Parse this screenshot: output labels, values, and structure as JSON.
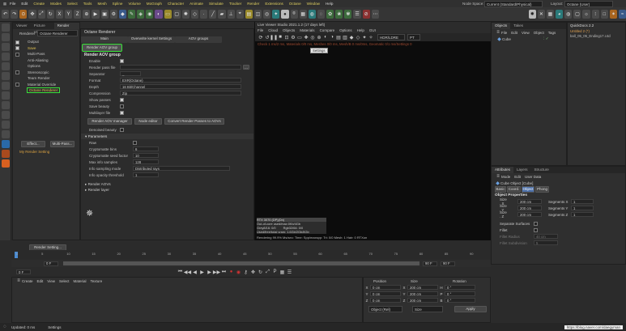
{
  "menubar": {
    "items": [
      "File",
      "Edit",
      "Create",
      "Modes",
      "Select",
      "Tools",
      "Mesh",
      "Spline",
      "Volume",
      "MoGraph",
      "Character",
      "Animate",
      "Simulate",
      "Tracker",
      "Render",
      "Extensions",
      "Octane",
      "Window",
      "Help"
    ],
    "node_space_label": "Node Space:",
    "node_space_value": "Current (Standard/Physical)",
    "layout_label": "Layout:",
    "layout_value": "Octane (User)"
  },
  "left_panel": {
    "tabs": [
      "Viewer",
      "Picture Viewer",
      "Render Settings"
    ],
    "renderer_label": "Renderer",
    "renderer_value": "Octane Renderer",
    "tree": [
      "Output",
      "Save",
      "Multi-Pass",
      "Anti-Aliasing",
      "Options",
      "Stereoscopic",
      "Team Render",
      "Material Override",
      "Octane Renderer"
    ],
    "effect_button": "Effect...",
    "multipass_button": "Multi-Pass...",
    "my_render_setting": "My Render Setting",
    "render_setting_button": "Render Setting..."
  },
  "octane": {
    "title": "Octane Renderer",
    "tab_row1": [
      "Main",
      "Overwrite kernel Settings",
      "AOV groups"
    ],
    "tab_active": "Render AOV group",
    "section": "Render AOV group",
    "enable_label": "Enable",
    "render_pass_file_label": "Render pass file",
    "separator_label": "Separator",
    "separator_value": "_",
    "format_label": "Format",
    "format_value": "EXR(Octane)",
    "depth_label": "Depth",
    "depth_value": "16 Bit/Channel",
    "compression_label": "Compression",
    "compression_value": "Zip",
    "show_passes_label": "Show passes",
    "save_beauty_label": "Save beauty",
    "multilayer_label": "Multilayer file",
    "btn_aov_manager": "Render AOV manager",
    "btn_node_editor": "Node editor",
    "btn_convert": "Convert Render Passes to AOVs",
    "denoised_label": "Denoised beauty",
    "parameters": "Parameters",
    "raw_label": "Raw",
    "crypto_bins_label": "Cryptomatte bins",
    "crypto_bins_value": "6",
    "crypto_seed_label": "Cryptomatte seed factor",
    "crypto_seed_value": "10",
    "max_info_label": "Max info samples",
    "max_info_value": "128",
    "info_mode_label": "Info sampling mode",
    "info_mode_value": "Distributed rays",
    "info_opacity_label": "Info opacity threshold",
    "info_opacity_value": "1",
    "render_aovs": "Render AOVs",
    "render_layer": "Render layer"
  },
  "viewer": {
    "title": "Live Viewer Studio 2021.1.2 (17 days left)",
    "menu": [
      "File",
      "Cloud",
      "Objects",
      "Materials",
      "Compare",
      "Options",
      "Help",
      "GUI"
    ],
    "mode_value": "HDR/LDRE",
    "pt_value": "PT",
    "status_line": "Check 1 ms/2 ms, Materials 0/0 ms, Meshes 0/0 ms, Mesh/B 0 ms/0ms, Geomatic 0/1 ms/Settings 0",
    "settings_tooltip": "Settings",
    "stats": [
      "RTX 3070 (DP)(Dn)",
      "Out-of-core used/max:0Kb/4Gb",
      "Grey8/16: 0/0",
      "Rgb32/64: 0/0",
      "Used/free/total vram: 1.6Gb/2Gb/8Gb"
    ],
    "bottom_bar": "Rendering   99.9%   Ms/sec:   Time:   Spp/maxspp:   Tri: 0/0   Mesh: 1   Hair: 0   RTXon"
  },
  "objects": {
    "tabs": [
      "Objects",
      "Takes"
    ],
    "menu": [
      "File",
      "Edit",
      "View",
      "Object",
      "Tags"
    ],
    "item": "Cube",
    "quickdocs_title": "QuickDocs 2.2",
    "quickdocs_items": [
      "Untitled 2 (*)",
      "ball_05_05_Ending17.c4d"
    ]
  },
  "attributes": {
    "tabs": [
      "Attributes",
      "Layers",
      "Structure"
    ],
    "menu": [
      "Mode",
      "Edit",
      "User Data"
    ],
    "object_name": "Cube Object [Cube]",
    "subtabs": [
      "Basic",
      "Coord.",
      "Object",
      "Phong"
    ],
    "section": "Object Properties",
    "size_x_label": "Size . X",
    "size_x_value": "200 cm",
    "size_y_label": "Size . Y",
    "size_y_value": "200 cm",
    "size_z_label": "Size . Z",
    "size_z_value": "200 cm",
    "seg_x_label": "Segments X",
    "seg_x_value": "1",
    "seg_y_label": "Segments Y",
    "seg_y_value": "1",
    "seg_z_label": "Segments Z",
    "seg_z_value": "1",
    "sep_surfaces_label": "Separate Surfaces",
    "fillet_label": "Fillet",
    "fillet_radius_label": "Fillet Radius",
    "fillet_radius_value": "40 cm",
    "fillet_sub_label": "Fillet Subdivision",
    "fillet_sub_value": "5"
  },
  "timeline": {
    "ticks": [
      "0",
      "5",
      "10",
      "15",
      "20",
      "25",
      "30",
      "35",
      "40",
      "45",
      "50",
      "55",
      "60",
      "65",
      "70",
      "75",
      "80",
      "85",
      "90"
    ],
    "start_value": "0 F",
    "end_value": "90 F",
    "end_value2": "90 F",
    "current_frame": "0 F"
  },
  "materials": {
    "menu": [
      "Create",
      "Edit",
      "View",
      "Select",
      "Material",
      "Texture"
    ]
  },
  "coords": {
    "headers": [
      "Position",
      "Size",
      "Rotation"
    ],
    "rows": [
      {
        "axis": "X",
        "pos": "0 cm",
        "size": "200 cm",
        "rot_axis": "H",
        "rot": "0 °"
      },
      {
        "axis": "Y",
        "pos": "0 cm",
        "size": "200 cm",
        "rot_axis": "P",
        "rot": "0 °"
      },
      {
        "axis": "Z",
        "pos": "0 cm",
        "size": "200 cm",
        "rot_axis": "B",
        "rot": "0 °"
      }
    ],
    "mode_value": "Object (Rel)",
    "size_mode_value": "Size",
    "apply_button": "Apply"
  },
  "status": {
    "text": "Updated: 0 ms",
    "settings": "Settings",
    "watermark": "https://blog.naver.com/daegyman"
  }
}
